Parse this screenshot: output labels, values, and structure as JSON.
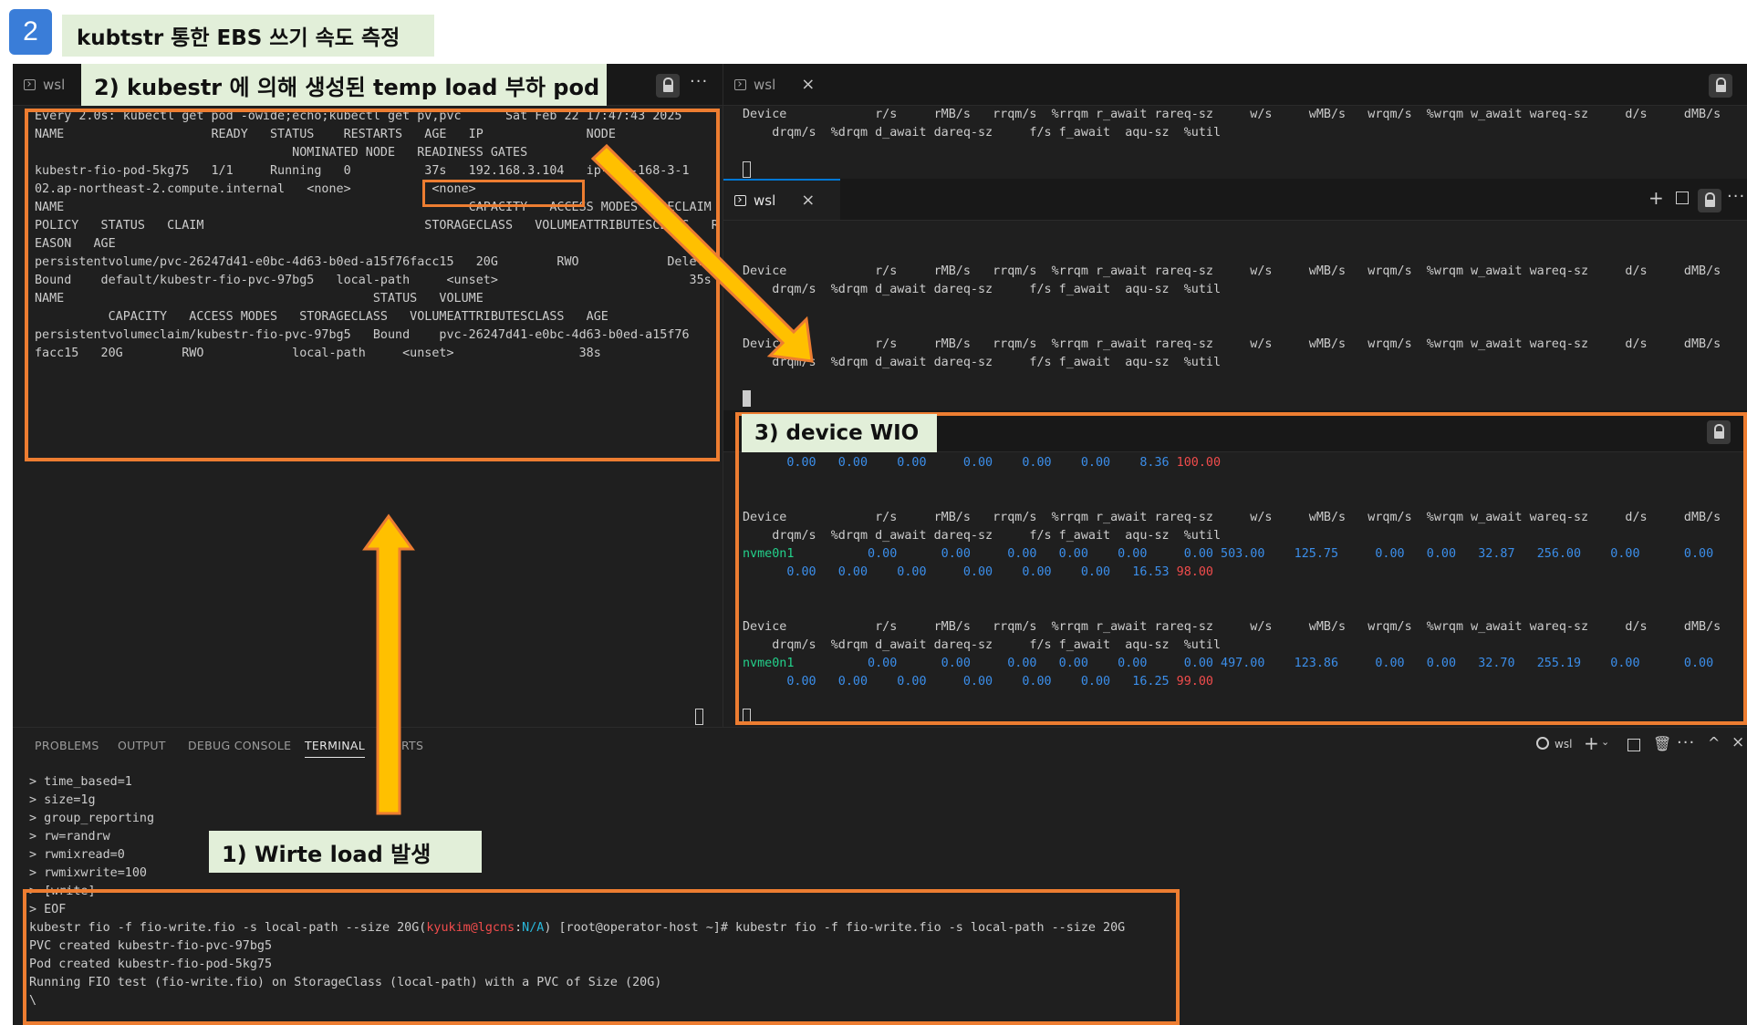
{
  "heading": {
    "number": "2",
    "title": "kubtstr 통한 EBS 쓰기 속도 측정"
  },
  "annotations": {
    "pod": "2) kubestr 에 의해 생성된 temp load 부하 pod",
    "wio": "3) device WIO",
    "write": "1) Wirte load 발생"
  },
  "left_pane": {
    "tab_label": "wsl",
    "lines": [
      "Every 2.0s: kubectl get pod -owide;echo;kubectl get pv,pvc      Sat Feb 22 17:47:43 2025",
      "",
      "NAME                    READY   STATUS    RESTARTS   AGE   IP              NODE",
      "                                   NOMINATED NODE   READINESS GATES",
      "kubestr-fio-pod-5kg75   1/1     Running   0          37s   192.168.3.104   ip-192-168-3-1",
      "02.ap-northeast-2.compute.internal   <none>           <none>",
      "",
      "NAME                                                       CAPACITY   ACCESS MODES   RECLAIM POLICY   STATUS   CLAIM                              STORAGECLASS   VOLUMEATTRIBUTESCLASS   REASON   AGE",
      "persistentvolume/pvc-26247d41-e0bc-4d63-b0ed-a15f76facc15   20G        RWO            Delete           Bound    default/kubestr-fio-pvc-97bg5   local-path     <unset>                          35s",
      "",
      "NAME                                          STATUS   VOLUME",
      "          CAPACITY   ACCESS MODES   STORAGECLASS   VOLUMEATTRIBUTESCLASS   AGE",
      "persistentvolumeclaim/kubestr-fio-pvc-97bg5   Bound    pvc-26247d41-e0bc-4d63-b0ed-a15f76",
      "facc15   20G        RWO            local-path     <unset>                 38s"
    ]
  },
  "right_top": {
    "tab_label": "wsl",
    "line1": "Device            r/s     rMB/s   rrqm/s  %rrqm r_await rareq-sz     w/s     wMB/s   wrqm/s  %wrqm w_await wareq-sz     d/s     dMB/s",
    "line2": "    drqm/s  %drqm d_await dareq-sz     f/s f_await  aqu-sz  %util"
  },
  "right_mid": {
    "tab_label": "wsl",
    "line1": "Device            r/s     rMB/s   rrqm/s  %rrqm r_await rareq-sz     w/s     wMB/s   wrqm/s  %wrqm w_await wareq-sz     d/s     dMB/s",
    "line2": "    drqm/s  %drqm d_await dareq-sz     f/s f_await  aqu-sz  %util"
  },
  "right_bottom": {
    "header1": "Device            r/s     rMB/s   rrqm/s  %rrqm r_await rareq-sz     w/s     wMB/s   wrqm/s  %wrqm w_await wareq-sz     d/s     dMB/s",
    "header2": "    drqm/s  %drqm d_await dareq-sz     f/s f_await  aqu-sz  %util",
    "first_util_prefix": "      0.00   0.00    0.00     0.00    0.00    0.00    8.36 ",
    "first_util": "100.00",
    "samples": [
      {
        "device": "nvme0n1",
        "read": "          0.00      0.00     0.00   0.00    0.00     0.00",
        "write": " 503.00    125.75     0.00   0.00   32.87   256.00",
        "disc": "    0.00      0.00",
        "ext": "      0.00   0.00    0.00     0.00    0.00    0.00   16.53 ",
        "util": "98.00"
      },
      {
        "device": "nvme0n1",
        "read": "          0.00      0.00     0.00   0.00    0.00     0.00",
        "write": " 497.00    123.86     0.00   0.00   32.70   255.19",
        "disc": "    0.00      0.00",
        "ext": "      0.00   0.00    0.00     0.00    0.00    0.00   16.25 ",
        "util": "99.00"
      }
    ]
  },
  "panel": {
    "tabs": [
      "PROBLEMS",
      "OUTPUT",
      "DEBUG CONSOLE",
      "TERMINAL",
      "PORTS"
    ],
    "terminal_name": "wsl",
    "lines": [
      "> time_based=1",
      "> size=1g",
      "> group_reporting",
      "> rw=randrw",
      "> rwmixread=0",
      "> rwmixwrite=100",
      "> [write]",
      "> EOF"
    ],
    "cmd_left": "kubestr fio -f fio-write.fio -s local-path --size 20G",
    "prompt_user": "kyukim@lgcns",
    "prompt_sep": ":",
    "prompt_ctx": "N/A",
    "prompt_rest": " [root@operator-host ~]# kubestr fio -f fio-write.fio -s local-path --size 20G",
    "output": [
      "PVC created kubestr-fio-pvc-97bg5",
      "Pod created kubestr-fio-pod-5kg75",
      "Running FIO test (fio-write.fio) on StorageClass (local-path) with a PVC of Size (20G)",
      "\\"
    ]
  }
}
